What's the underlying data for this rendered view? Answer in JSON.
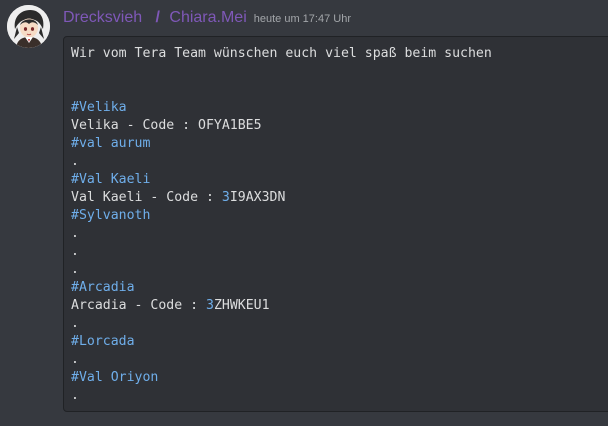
{
  "message": {
    "author": {
      "name": "Drecksvieh",
      "separator": "/",
      "alt_name": "Chiara.Mei"
    },
    "timestamp": "heute um 17:47 Uhr",
    "code_lines": [
      {
        "text": "Wir vom Tera Team wünschen euch viel spaß beim suchen",
        "style": "plain"
      },
      {
        "text": "",
        "style": "plain"
      },
      {
        "text": "",
        "style": "plain"
      },
      {
        "text": "#Velika",
        "style": "heading"
      },
      {
        "text": "Velika - Code : OFYA1BE5",
        "style": "plain"
      },
      {
        "text": "#val aurum",
        "style": "heading"
      },
      {
        "text": ".",
        "style": "plain"
      },
      {
        "text": "#Val Kaeli",
        "style": "heading"
      },
      {
        "prefix": "Val Kaeli - Code : ",
        "num": "3",
        "suffix": "I9AX3DN",
        "style": "code"
      },
      {
        "text": "#Sylvanoth",
        "style": "heading"
      },
      {
        "text": ".",
        "style": "plain"
      },
      {
        "text": ".",
        "style": "plain"
      },
      {
        "text": ".",
        "style": "plain"
      },
      {
        "text": "#Arcadia",
        "style": "heading"
      },
      {
        "prefix": "Arcadia - Code : ",
        "num": "3",
        "suffix": "ZHWKEU1",
        "style": "code"
      },
      {
        "text": ".",
        "style": "plain"
      },
      {
        "text": "#Lorcada",
        "style": "heading"
      },
      {
        "text": ".",
        "style": "plain"
      },
      {
        "text": "#Val Oriyon",
        "style": "heading"
      },
      {
        "text": ".",
        "style": "plain"
      }
    ]
  },
  "colors": {
    "background": "#36393f",
    "codeblock_bg": "#2f3136",
    "username": "#7f58b8",
    "heading": "#6faeea",
    "text": "#dcddde",
    "timestamp": "#a3a6aa"
  },
  "icons": {
    "avatar": "user-avatar-anime-character"
  }
}
